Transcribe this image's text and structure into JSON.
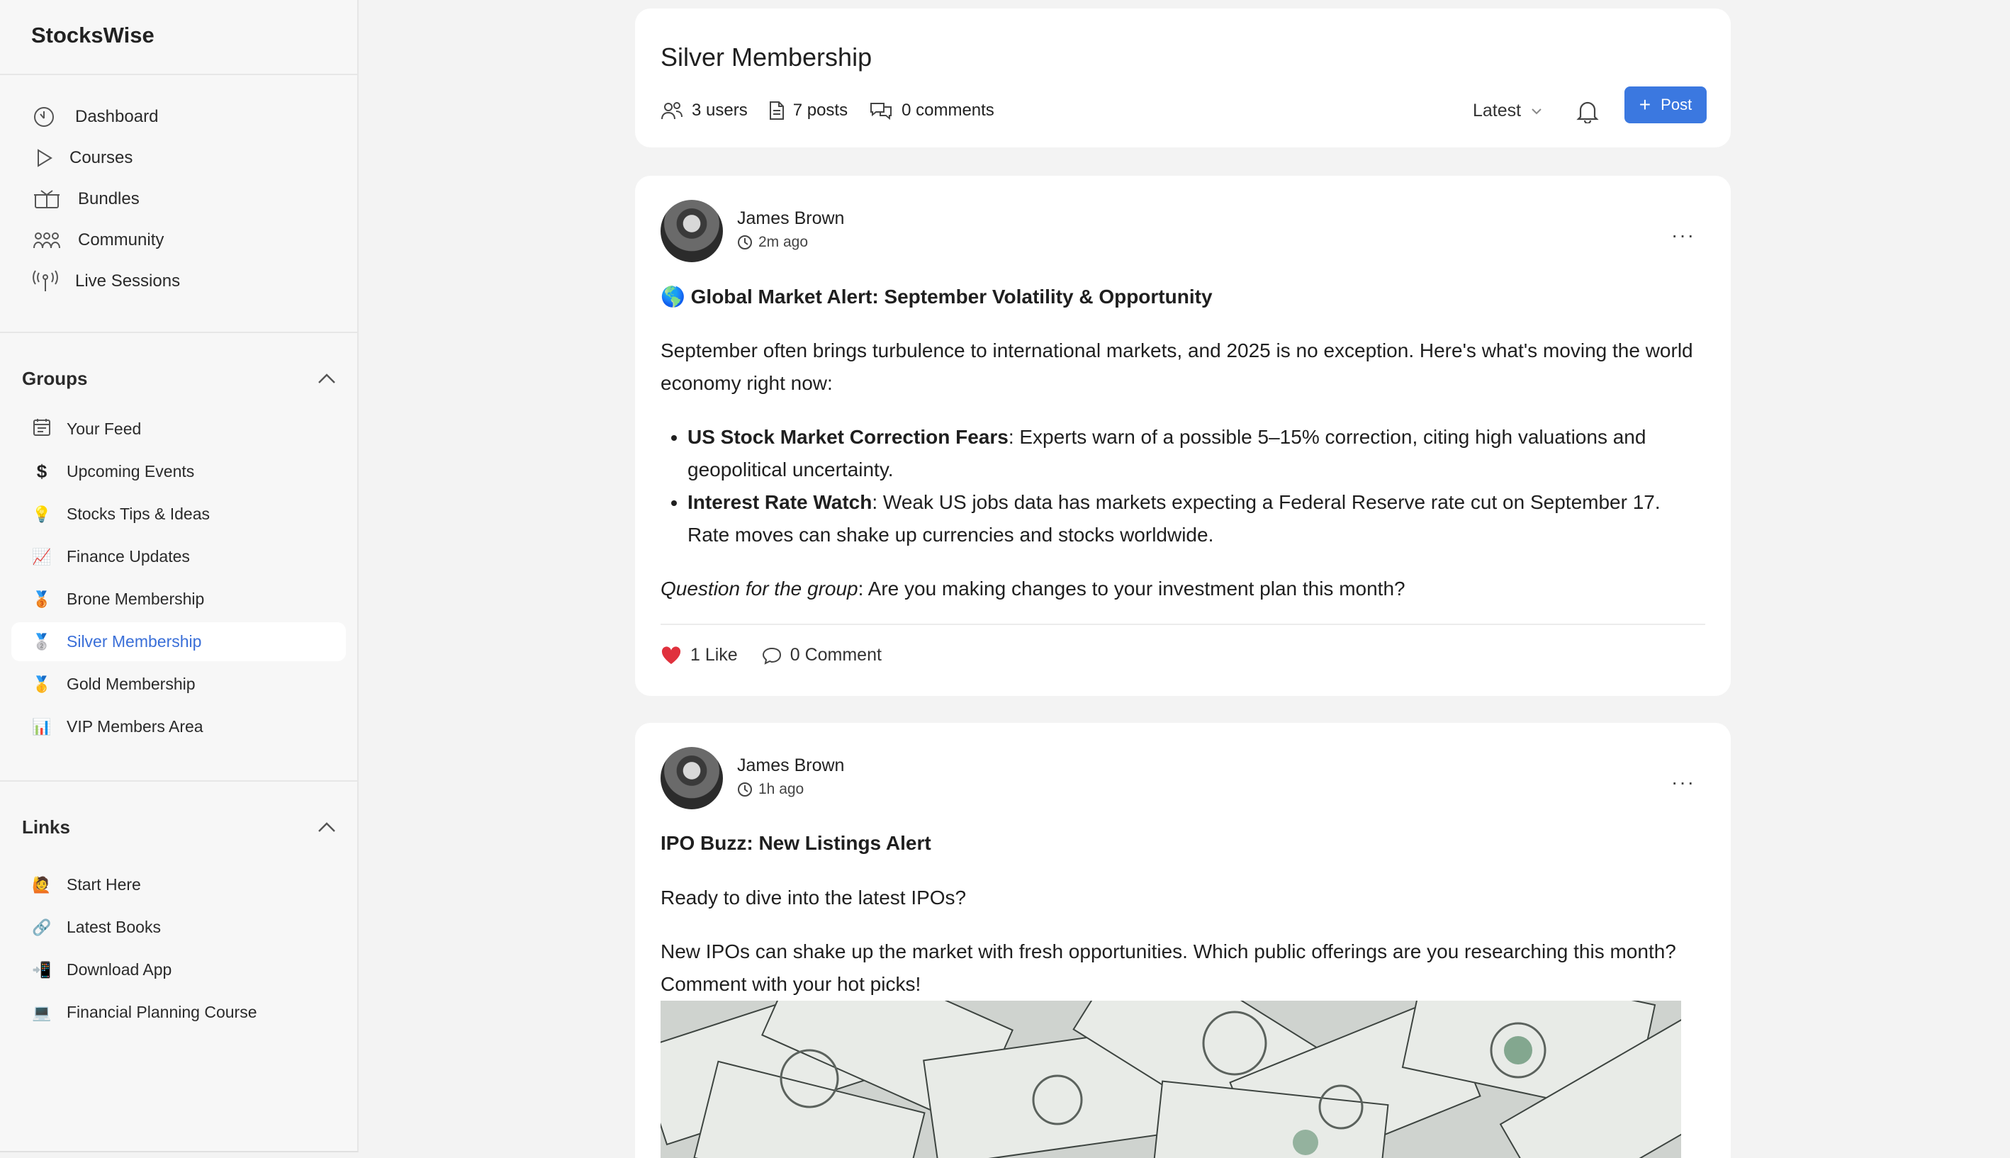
{
  "app": {
    "brand": "StocksWise"
  },
  "sidebar": {
    "nav": [
      {
        "label": "Dashboard",
        "icon": "dashboard-icon"
      },
      {
        "label": "Courses",
        "icon": "play-icon"
      },
      {
        "label": "Bundles",
        "icon": "box-icon"
      },
      {
        "label": "Community",
        "icon": "community-icon"
      },
      {
        "label": "Live Sessions",
        "icon": "broadcast-icon"
      }
    ],
    "groups_title": "Groups",
    "groups": [
      {
        "label": "Your Feed",
        "icon": "feed-icon"
      },
      {
        "label": "Upcoming Events",
        "icon": "dollar-icon"
      },
      {
        "label": "Stocks Tips & Ideas",
        "icon": "lightbulb-icon"
      },
      {
        "label": "Finance Updates",
        "icon": "chart-up-icon"
      },
      {
        "label": "Brone Membership",
        "icon": "bronze-medal-icon"
      },
      {
        "label": "Silver Membership",
        "icon": "silver-medal-icon",
        "active": true
      },
      {
        "label": "Gold Membership",
        "icon": "gold-medal-icon"
      },
      {
        "label": "VIP Members Area",
        "icon": "bar-chart-icon"
      }
    ],
    "links_title": "Links",
    "links": [
      {
        "label": "Start Here",
        "icon": "wave-icon"
      },
      {
        "label": "Latest Books",
        "icon": "link-icon"
      },
      {
        "label": "Download App",
        "icon": "phone-icon"
      },
      {
        "label": "Financial Planning Course",
        "icon": "laptop-icon"
      }
    ]
  },
  "header": {
    "title": "Silver Membership",
    "users": "3 users",
    "posts": "7 posts",
    "comments": "0 comments",
    "sort": "Latest",
    "post_button": "Post"
  },
  "posts": [
    {
      "author": "James Brown",
      "time": "2m ago",
      "title": "🌎 Global Market Alert: September Volatility & Opportunity",
      "intro": "September often brings turbulence to international markets, and 2025 is no exception. Here's what's moving the world economy right now:",
      "bullets": [
        {
          "bold": "US Stock Market Correction Fears",
          "text": ": Experts warn of a possible 5–15% correction, citing high valuations and geopolitical uncertainty."
        },
        {
          "bold": "Interest Rate Watch",
          "text": ": Weak US jobs data has markets expecting a Federal Reserve rate cut on September 17. Rate moves can shake up currencies and stocks worldwide."
        }
      ],
      "question_label": "Question for the group",
      "question": ": Are you making changes to your investment plan this month?",
      "likes": "1 Like",
      "comments": "0 Comment"
    },
    {
      "author": "James Brown",
      "time": "1h ago",
      "title": "IPO Buzz: New Listings Alert",
      "line1": "Ready to dive into the latest IPOs?",
      "line2": "New IPOs can shake up the market with fresh opportunities. Which public offerings are you researching this month? Comment with your hot picks!"
    }
  ],
  "colors": {
    "accent": "#3b78e0",
    "active_text": "#3a6fd8",
    "heart": "#e0313d"
  }
}
